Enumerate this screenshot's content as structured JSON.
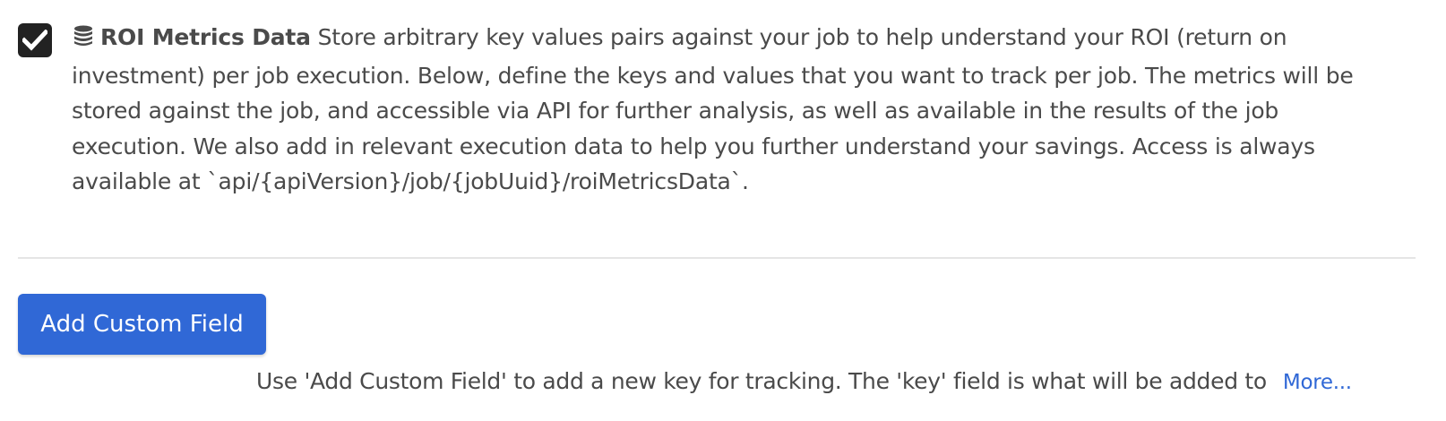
{
  "setting": {
    "checked": true,
    "icon": "database-icon",
    "title": "ROI Metrics Data",
    "description": " Store arbitrary key values pairs against your job to help understand your ROI (return on investment) per job execution. Below, define the keys and values that you want to track per job. The metrics will be stored against the job, and accessible via API for further analysis, as well as available in the results of the job execution. We also add in relevant execution data to help you further understand your savings. Access is always available at `api/{apiVersion}/job/{jobUuid}/roiMetricsData`."
  },
  "actions": {
    "add_custom_field_label": "Add Custom Field"
  },
  "help": {
    "text": "Use 'Add Custom Field' to add a new key for tracking. The 'key' field is what will be added to",
    "more_link": "More..."
  },
  "colors": {
    "accent": "#3068d6",
    "text": "#4a4a4a",
    "checkbox": "#222222",
    "divider": "#e5e5e5"
  }
}
